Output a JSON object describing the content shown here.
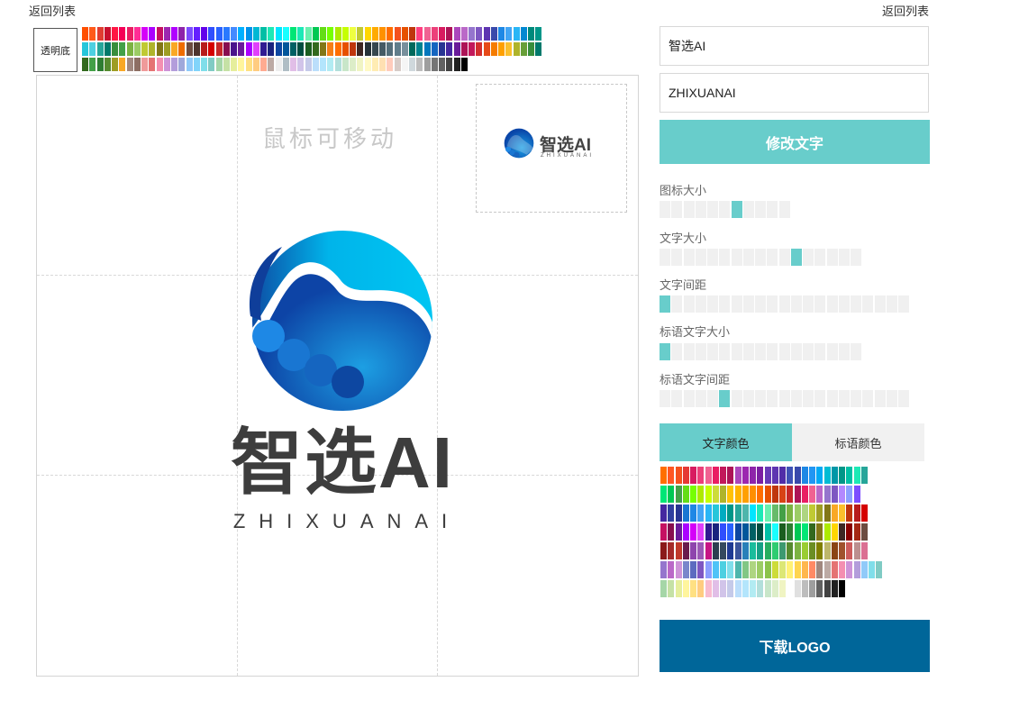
{
  "nav": {
    "back_left": "返回列表",
    "back_right": "返回列表"
  },
  "background": {
    "transparent_label": "透明底"
  },
  "canvas": {
    "drag_hint": "鼠标可移动"
  },
  "logo": {
    "name": "智选AI",
    "slogan": "ZHIXUANAI",
    "icon": "hand-circle-logo-icon",
    "gradient_colors": [
      "#00c6f2",
      "#0f3e9a"
    ]
  },
  "preview": {
    "name": "智选AI",
    "slogan": "ZHIXUANAI"
  },
  "inputs": {
    "name_value": "智选AI",
    "slogan_value": "ZHIXUANAI"
  },
  "buttons": {
    "modify": "修改文字",
    "download": "下载LOGO"
  },
  "sliders": [
    {
      "label": "图标大小",
      "segments": 11,
      "value": 7
    },
    {
      "label": "文字大小",
      "segments": 17,
      "value": 12
    },
    {
      "label": "文字间距",
      "segments": 21,
      "value": 1
    },
    {
      "label": "标语文字大小",
      "segments": 17,
      "value": 1
    },
    {
      "label": "标语文字间距",
      "segments": 21,
      "value": 6
    }
  ],
  "color_tabs": [
    {
      "label": "文字颜色",
      "active": true
    },
    {
      "label": "标语颜色",
      "active": false
    }
  ],
  "colors": {
    "accent": "#68cdcb",
    "download": "#006699",
    "top_palette": [
      [
        "#ff4f00",
        "#ff5a1a",
        "#e03c31",
        "#c8102e",
        "#ff1744",
        "#f50057",
        "#e91e63",
        "#ff2d95",
        "#d500f9",
        "#aa00ff",
        "#c51162",
        "#9c27b0",
        "#b000ff",
        "#8e24aa",
        "#7c4dff",
        "#651fff",
        "#6200ea",
        "#304ffe",
        "#2962ff",
        "#2979ff",
        "#448aff",
        "#00b0ff",
        "#0091ea",
        "#00b8d4",
        "#00bfa5",
        "#1de9b6",
        "#00e5ff",
        "#18ffff",
        "#00e676",
        "#1de9b6",
        "#69f0ae",
        "#00c853",
        "#64dd17",
        "#76ff03",
        "#aeea00",
        "#c6ff00",
        "#eeff41",
        "#c0ca33",
        "#ffd600",
        "#ffab00",
        "#ff9100",
        "#ff6d00",
        "#f4511e",
        "#e65100",
        "#bf360c",
        "#ff4081",
        "#f06292",
        "#ec407a",
        "#d81b60",
        "#ad1457",
        "#ab47bc",
        "#ba68c8",
        "#9575cd",
        "#7e57c2",
        "#5e35b1",
        "#3949ab",
        "#1e88e5",
        "#42a5f5",
        "#29b6f6",
        "#0288d1",
        "#00897b",
        "#009688"
      ],
      [
        "#26c6da",
        "#4dd0e1",
        "#26a69a",
        "#00796b",
        "#388e3c",
        "#43a047",
        "#7cb342",
        "#9ccc65",
        "#c0ca33",
        "#afb42b",
        "#827717",
        "#9e9d24",
        "#f9a825",
        "#ef6c00",
        "#6d4c41",
        "#4e342e",
        "#b71c1c",
        "#d50000",
        "#c62828",
        "#880e4f",
        "#4a148c",
        "#6a1b9a",
        "#aa00ff",
        "#e040fb",
        "#311b92",
        "#1a237e",
        "#0d47a1",
        "#01579b",
        "#006064",
        "#004d40",
        "#1b5e20",
        "#33691e",
        "#827717",
        "#f57f17",
        "#ff6f00",
        "#e65100",
        "#bf360c",
        "#3e2723",
        "#263238",
        "#37474f",
        "#455a64",
        "#546e7a",
        "#607d8b",
        "#78909c",
        "#00695c",
        "#00838f",
        "#0277bd",
        "#1565c0",
        "#283593",
        "#4527a0",
        "#6a1b9a",
        "#ad1457",
        "#c2185b",
        "#d32f2f",
        "#e64a19",
        "#f57c00",
        "#ffa000",
        "#fbc02d",
        "#afb42b",
        "#689f38",
        "#388e3c",
        "#00796b"
      ],
      [
        "#33691e",
        "#43a047",
        "#2e7d32",
        "#558b2f",
        "#9e9d24",
        "#f9a825",
        "#a1887f",
        "#8d6e63",
        "#ef9a9a",
        "#e57373",
        "#f48fb1",
        "#ce93d8",
        "#b39ddb",
        "#9fa8da",
        "#90caf9",
        "#81d4fa",
        "#80deea",
        "#80cbc4",
        "#a5d6a7",
        "#c5e1a5",
        "#e6ee9c",
        "#fff59d",
        "#ffe082",
        "#ffcc80",
        "#ffab91",
        "#bcaaa4",
        "#eeeeee",
        "#b0bec5",
        "#e1bee7",
        "#d1c4e9",
        "#c5cae9",
        "#bbdefb",
        "#b3e5fc",
        "#b2ebf2",
        "#b2dfdb",
        "#c8e6c9",
        "#dcedc8",
        "#f0f4c3",
        "#fff9c4",
        "#ffecb3",
        "#ffe0b2",
        "#ffccbc",
        "#d7ccc8",
        "#f5f5f5",
        "#cfd8dc",
        "#bdbdbd",
        "#9e9e9e",
        "#757575",
        "#616161",
        "#424242",
        "#212121",
        "#000000"
      ]
    ],
    "right_palette": [
      [
        "#ff6f00",
        "#ff5722",
        "#f4511e",
        "#e53935",
        "#d81b60",
        "#ec407a",
        "#f06292",
        "#e91e63",
        "#c2185b",
        "#ad1457",
        "#ab47bc",
        "#9c27b0",
        "#8e24aa",
        "#7b1fa2",
        "#673ab7",
        "#5e35b1",
        "#512da8",
        "#3f51b5",
        "#3949ab",
        "#1e88e5",
        "#2196f3",
        "#03a9f4",
        "#00bcd4",
        "#0097a7",
        "#009688",
        "#00bfa5",
        "#1de9b6",
        "#26a69a"
      ],
      [
        "#00e676",
        "#00c853",
        "#43a047",
        "#64dd17",
        "#76ff03",
        "#aeea00",
        "#c6ff00",
        "#cddc39",
        "#afb42b",
        "#ffc107",
        "#ffb300",
        "#ffa000",
        "#ff8f00",
        "#ff6f00",
        "#e65100",
        "#bf360c",
        "#d84315",
        "#c62828",
        "#ad1457",
        "#e91e63",
        "#f06292",
        "#ba68c8",
        "#9575cd",
        "#7e57c2",
        "#b388ff",
        "#8c9eff",
        "#7c4dff"
      ],
      [
        "#4527a0",
        "#303f9f",
        "#283593",
        "#1976d2",
        "#1e88e5",
        "#42a5f5",
        "#29b6f6",
        "#26c6da",
        "#00acc1",
        "#009688",
        "#26a69a",
        "#4db6ac",
        "#00e5ff",
        "#1de9b6",
        "#69f0ae",
        "#66bb6a",
        "#43a047",
        "#7cb342",
        "#9ccc65",
        "#aed581",
        "#c0ca33",
        "#9e9d24",
        "#827717",
        "#f9a825",
        "#fbc02d",
        "#bf360c",
        "#b71c1c",
        "#d50000"
      ],
      [
        "#c51162",
        "#880e4f",
        "#6a1b9a",
        "#aa00ff",
        "#d500f9",
        "#e040fb",
        "#311b92",
        "#1a237e",
        "#304ffe",
        "#2962ff",
        "#0d47a1",
        "#01579b",
        "#006064",
        "#004d40",
        "#00bfa5",
        "#18ffff",
        "#1b5e20",
        "#2e7d32",
        "#00c853",
        "#00e676",
        "#33691e",
        "#827717",
        "#aeea00",
        "#ffd600",
        "#3e2723",
        "#880000",
        "#a52714",
        "#6d4c41"
      ],
      [
        "#8b1a1a",
        "#a52a2a",
        "#c0392b",
        "#6a1b4d",
        "#8e44ad",
        "#9b59b6",
        "#c71585",
        "#2c3e50",
        "#34495e",
        "#1f3a93",
        "#3a539b",
        "#2980b9",
        "#1abc9c",
        "#16a085",
        "#27ae60",
        "#2ecc71",
        "#3d9970",
        "#558b2f",
        "#7cb342",
        "#9acd32",
        "#6b8e23",
        "#808000",
        "#bdb76b",
        "#8b4513",
        "#a0522d",
        "#cd5c5c",
        "#bc8f8f",
        "#db7093"
      ],
      [
        "#9575cd",
        "#ba68c8",
        "#ce93d8",
        "#7986cb",
        "#5c6bc0",
        "#7e57c2",
        "#8c9eff",
        "#4fc3f7",
        "#4dd0e1",
        "#80deea",
        "#4db6ac",
        "#81c784",
        "#aed581",
        "#9ccc65",
        "#8bc34a",
        "#cddc39",
        "#dce775",
        "#fff176",
        "#ffd54f",
        "#ffb74d",
        "#ff8a65",
        "#a1887f",
        "#bcaaa4",
        "#e57373",
        "#f48fb1",
        "#ce93d8",
        "#b39ddb",
        "#90caf9",
        "#80deea",
        "#80cbc4"
      ],
      [
        "#a5d6a7",
        "#c5e1a5",
        "#e6ee9c",
        "#fff59d",
        "#ffe082",
        "#ffcc80",
        "#f8bbd0",
        "#e1bee7",
        "#d1c4e9",
        "#c5cae9",
        "#bbdefb",
        "#b3e5fc",
        "#b2ebf2",
        "#b2dfdb",
        "#c8e6c9",
        "#dcedc8",
        "#f0f4c3",
        "#ffffff",
        "#e0e0e0",
        "#bdbdbd",
        "#9e9e9e",
        "#616161",
        "#424242",
        "#212121",
        "#000000"
      ]
    ]
  }
}
